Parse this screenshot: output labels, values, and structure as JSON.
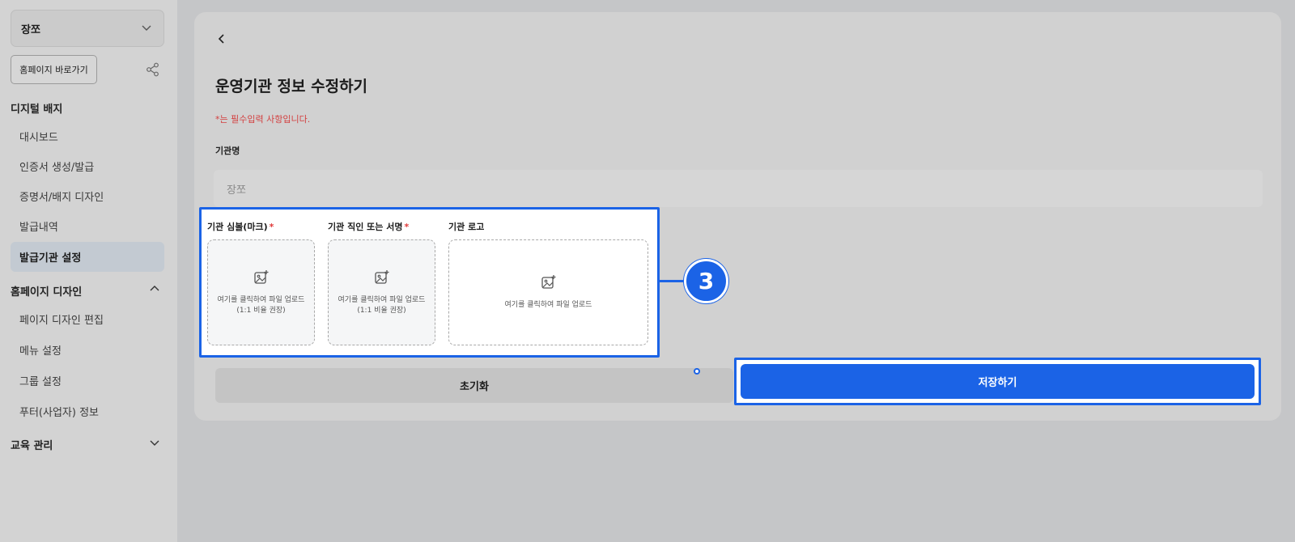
{
  "sidebar": {
    "org_select": "장쪼",
    "home_button": "홈페이지 바로가기",
    "groups": [
      {
        "label": "디지털 배지"
      },
      {
        "label": "홈페이지 디자인"
      },
      {
        "label": "교육 관리"
      }
    ],
    "items": [
      {
        "label": "대시보드"
      },
      {
        "label": "인증서 생성/발급"
      },
      {
        "label": "증명서/배지 디자인"
      },
      {
        "label": "발급내역"
      },
      {
        "label": "발급기관 설정"
      },
      {
        "label": "페이지 디자인 편집"
      },
      {
        "label": "메뉴 설정"
      },
      {
        "label": "그룹 설정"
      },
      {
        "label": "푸터(사업자) 정보"
      }
    ]
  },
  "main": {
    "title": "운영기관 정보 수정하기",
    "required_note": "*는 필수입력 사항입니다.",
    "name_label": "기관명",
    "name_value": "장쪼",
    "uploads": [
      {
        "label": "기관 심볼(마크)",
        "required": "*",
        "text1": "여기를 클릭하여 파일 업로드",
        "text2": "(1:1 비율 권장)"
      },
      {
        "label": "기관 직인 또는 서명",
        "required": "*",
        "text1": "여기를 클릭하여 파일 업로드",
        "text2": "(1:1 비율 권장)"
      },
      {
        "label": "기관 로고",
        "text1": "여기를 클릭하여 파일 업로드"
      }
    ],
    "reset_button": "초기화",
    "save_button": "저장하기"
  },
  "callout": {
    "number": "3",
    "color": "#1b63e6"
  }
}
